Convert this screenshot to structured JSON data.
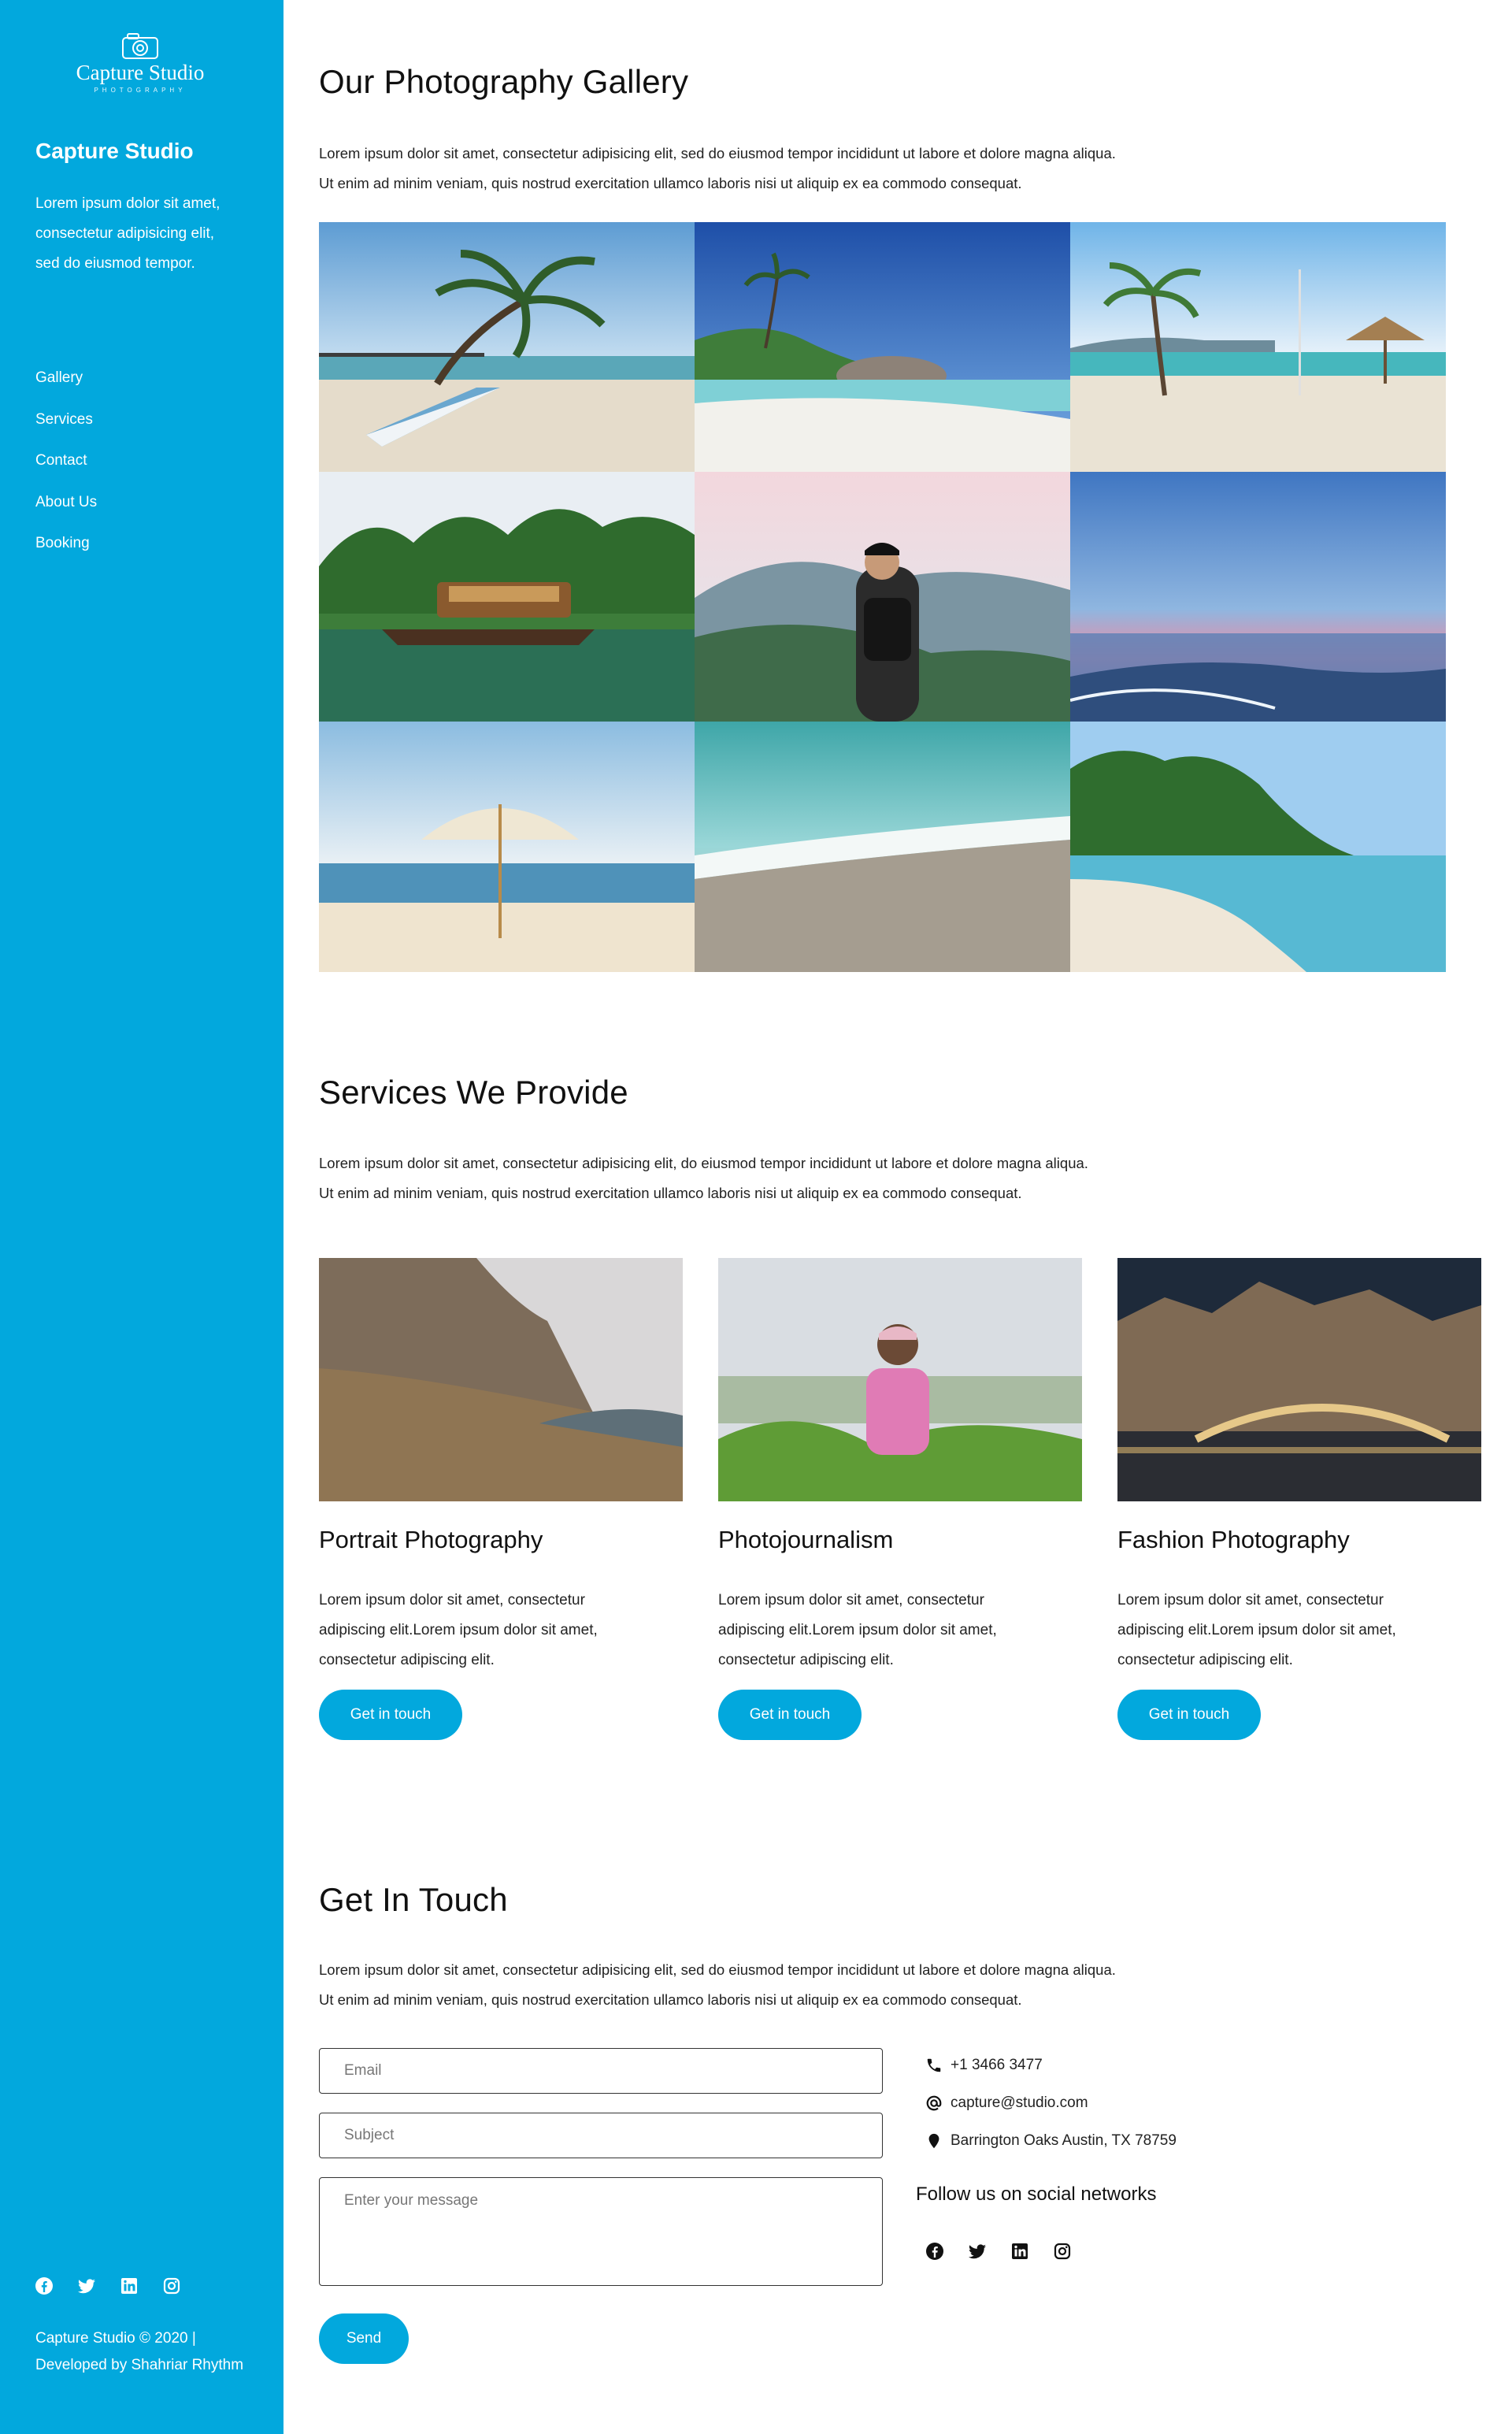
{
  "sidebar": {
    "logo": {
      "name": "Capture Studio",
      "sub": "PHOTOGRAPHY"
    },
    "title": "Capture Studio",
    "description": "Lorem ipsum dolor sit amet, consectetur adipisicing elit, sed do eiusmod tempor.",
    "nav": [
      "Gallery",
      "Services",
      "Contact",
      "About Us",
      "Booking"
    ],
    "social_icons": [
      "facebook-icon",
      "twitter-icon",
      "linkedin-icon",
      "instagram-icon"
    ],
    "copyright_line1": "Capture Studio © 2020 |",
    "copyright_line2": "Developed by Shahriar Rhythm"
  },
  "gallery": {
    "title": "Our Photography Gallery",
    "line1": "Lorem ipsum dolor sit amet, consectetur adipisicing elit, sed do eiusmod tempor incididunt ut labore et dolore magna aliqua.",
    "line2": "Ut enim ad minim veniam, quis nostrud exercitation ullamco laboris nisi ut aliquip ex ea commodo consequat."
  },
  "services": {
    "title": "Services We Provide",
    "line1": "Lorem ipsum dolor sit amet, consectetur adipisicing elit, do eiusmod tempor incididunt ut labore et dolore magna aliqua.",
    "line2": "Ut enim ad minim veniam, quis nostrud exercitation ullamco laboris nisi ut aliquip ex ea commodo consequat.",
    "cards": [
      {
        "title": "Portrait Photography",
        "line1": "Lorem ipsum dolor sit amet, consectetur",
        "line2": "adipiscing elit.Lorem ipsum dolor sit amet,",
        "line3": "consectetur adipiscing elit.",
        "button": "Get in touch"
      },
      {
        "title": "Photojournalism",
        "line1": "Lorem ipsum dolor sit amet, consectetur",
        "line2": "adipiscing elit.Lorem ipsum dolor sit amet,",
        "line3": "consectetur adipiscing elit.",
        "button": "Get in touch"
      },
      {
        "title": "Fashion Photography",
        "line1": "Lorem ipsum dolor sit amet, consectetur",
        "line2": "adipiscing elit.Lorem ipsum dolor sit amet,",
        "line3": "consectetur adipiscing elit.",
        "button": "Get in touch"
      }
    ]
  },
  "contact": {
    "title": "Get In Touch",
    "line1": "Lorem ipsum dolor sit amet, consectetur adipisicing elit, sed do eiusmod tempor incididunt ut labore et dolore magna aliqua.",
    "line2": "Ut enim ad minim veniam, quis nostrud exercitation ullamco laboris nisi ut aliquip ex ea commodo consequat.",
    "form": {
      "email_placeholder": "Email",
      "subject_placeholder": "Subject",
      "message_placeholder": "Enter your message",
      "send_label": "Send"
    },
    "phone": "+1 3466 3477",
    "email": "capture@studio.com",
    "address": "Barrington Oaks Austin, TX 78759",
    "follow_label": "Follow us on social networks",
    "social_icons": [
      "facebook-icon",
      "twitter-icon",
      "linkedin-icon",
      "instagram-icon"
    ]
  },
  "colors": {
    "accent": "#02a8dd",
    "text": "#111111",
    "background": "#ffffff"
  }
}
